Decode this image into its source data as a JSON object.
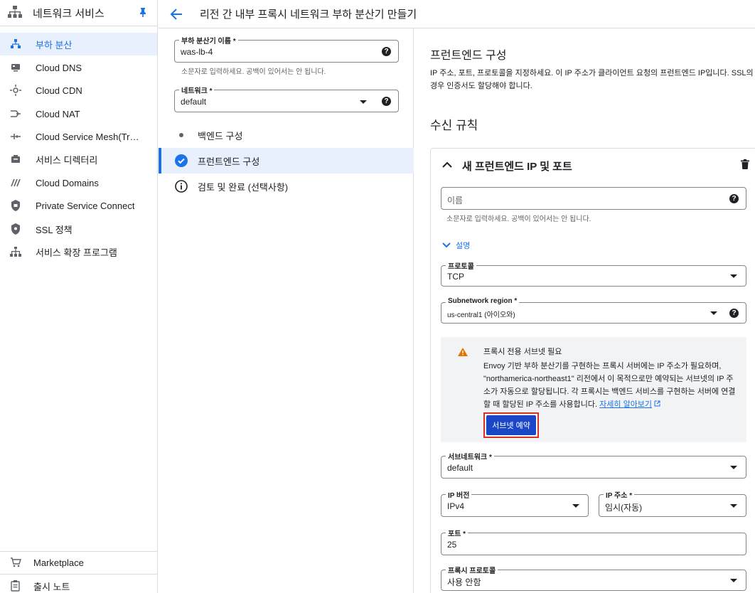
{
  "sidebar": {
    "title": "네트워크 서비스",
    "items": [
      {
        "label": "부하 분산",
        "icon": "load-balancer-icon"
      },
      {
        "label": "Cloud DNS",
        "icon": "dns-icon"
      },
      {
        "label": "Cloud CDN",
        "icon": "cdn-icon"
      },
      {
        "label": "Cloud NAT",
        "icon": "nat-icon"
      },
      {
        "label": "Cloud Service Mesh(Traffic Director)",
        "icon": "service-mesh-icon"
      },
      {
        "label": "서비스 디렉터리",
        "icon": "service-directory-icon"
      },
      {
        "label": "Cloud Domains",
        "icon": "domains-icon"
      },
      {
        "label": "Private Service Connect",
        "icon": "private-service-connect-icon"
      },
      {
        "label": "SSL 정책",
        "icon": "ssl-policy-icon"
      },
      {
        "label": "서비스 확장 프로그램",
        "icon": "service-extensions-icon"
      }
    ],
    "bottom": [
      {
        "label": "Marketplace",
        "icon": "marketplace-icon"
      },
      {
        "label": "출시 노트",
        "icon": "release-notes-icon"
      }
    ]
  },
  "header": {
    "title": "리전 간 내부 프록시 네트워크 부하 분산기 만들기"
  },
  "form": {
    "lb_name": {
      "label": "부하 분산기 이름 *",
      "value": "was-lb-4",
      "hint": "소문자로 입력하세요. 공백이 있어서는 안 됩니다."
    },
    "network": {
      "label": "네트워크 *",
      "value": "default"
    },
    "steps": [
      {
        "label": "백엔드 구성",
        "state": "pending"
      },
      {
        "label": "프런트엔드 구성",
        "state": "active"
      },
      {
        "label": "검토 및 완료 (선택사항)",
        "state": "info"
      }
    ]
  },
  "frontend": {
    "title": "프런트엔드 구성",
    "description": "IP 주소, 포트, 프로토콜을 지정하세요. 이 IP 주소가 클라이언트 요청의 프런트엔드 IP입니다. SSL의 경우 인증서도 할당해야 합니다.",
    "rules_title": "수신 규칙",
    "card_title": "새 프런트엔드 IP 및 포트",
    "name_placeholder": "이름",
    "name_hint": "소문자로 입력하세요. 공백이 있어서는 안 됩니다.",
    "desc_toggle": "설명",
    "protocol": {
      "label": "프로토콜",
      "value": "TCP"
    },
    "subnet_region": {
      "label": "Subnetwork region *",
      "value": "us-central1 (아이오와)"
    },
    "warning": {
      "title": "프록시 전용 서브넷 필요",
      "body": "Envoy 기반 부하 분산기를 구현하는 프록시 서버에는 IP 주소가 필요하며, \"northamerica-northeast1\" 리전에서 이 목적으로만 예약되는 서브넷의 IP 주소가 자동으로 할당됩니다. 각 프록시는 백엔드 서비스를 구현하는 서버에 연결할 때 할당된 IP 주소를 사용합니다.",
      "link": "자세히 알아보기",
      "button": "서브넷 예약"
    },
    "subnetwork": {
      "label": "서브네트워크 *",
      "value": "default"
    },
    "ip_version": {
      "label": "IP 버전",
      "value": "IPv4"
    },
    "ip_address": {
      "label": "IP 주소 *",
      "value": "임시(자동)"
    },
    "port": {
      "label": "포트 *",
      "value": "25"
    },
    "proxy_protocol": {
      "label": "프록시 프로토콜",
      "value": "사용 안함"
    }
  }
}
